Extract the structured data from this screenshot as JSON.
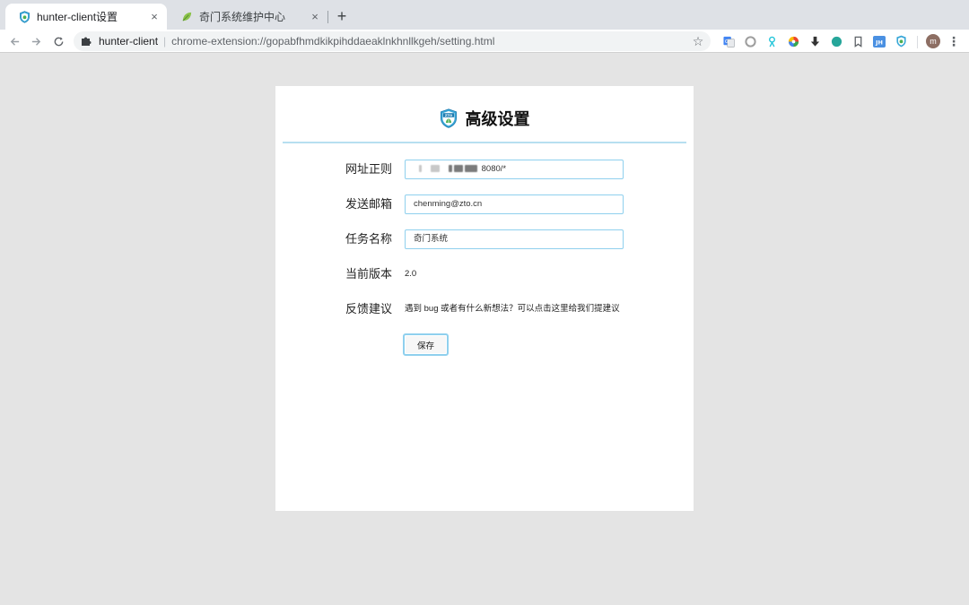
{
  "browser": {
    "tabs": [
      {
        "title": "hunter-client设置",
        "active": true,
        "favicon": "zto-shield-icon"
      },
      {
        "title": "奇门系统维护中心",
        "active": false,
        "favicon": "leaf-icon"
      }
    ],
    "new_tab_symbol": "+",
    "close_symbol": "×",
    "address_bar": {
      "site_name": "hunter-client",
      "separator": "|",
      "url": "chrome-extension://gopabfhmdkikpihddaeaklnkhnllkgeh/setting.html"
    },
    "profile_initial": "m",
    "extension_icons": [
      "translate-icon",
      "circle-icon",
      "person-icon",
      "color-wheel-icon",
      "download-arrow-icon",
      "teal-dot-icon",
      "bookmark-icon",
      "jh-badge-icon",
      "zto-shield-icon"
    ],
    "extension_badge_text": "JH"
  },
  "settings": {
    "title": "高级设置",
    "logo_text": "ZTO",
    "fields": {
      "url_regex": {
        "label": "网址正则",
        "value_suffix": "8080/*"
      },
      "email": {
        "label": "发送邮箱",
        "value": "chenming@zto.cn"
      },
      "task_name": {
        "label": "任务名称",
        "value": "奇门系统"
      },
      "version": {
        "label": "当前版本",
        "value": "2.0"
      },
      "feedback": {
        "label": "反馈建议",
        "value": "遇到 bug 或者有什么新想法？可以点击这里给我们提建议"
      }
    },
    "save_label": "保存"
  },
  "colors": {
    "accent_border": "#8fd0ee",
    "rule": "#b7dff0",
    "page_bg": "#e4e4e4",
    "tabstrip_bg": "#dee1e6"
  }
}
